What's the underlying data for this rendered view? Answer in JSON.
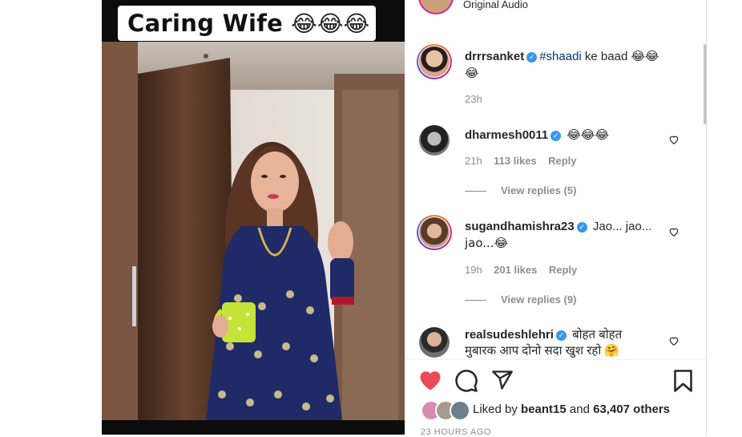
{
  "video": {
    "caption_title": "Caring Wife",
    "caption_emojis": "😂😂😂"
  },
  "audio": {
    "label": "Original Audio"
  },
  "post": {
    "username": "drrrsanket",
    "hashtag": "#shaadi",
    "text": " ke baad ",
    "emojis": "😂😂",
    "emojis_line2": "😂",
    "age": "23h"
  },
  "comments": [
    {
      "username": "dharmesh0011",
      "text": "😂😂😂",
      "age": "21h",
      "likes": "113 likes",
      "reply_label": "Reply",
      "view_replies": "View replies (5)"
    },
    {
      "username": "sugandhamishra23",
      "text": "Jao... jao...",
      "text_line2": "jao...😂",
      "age": "19h",
      "likes": "201 likes",
      "reply_label": "Reply",
      "view_replies": "View replies (9)"
    },
    {
      "username": "realsudeshlehri",
      "text": "बोहत बोहत",
      "text_line2": "मुबारक आप दोनो सदा खुश रहो 🤗"
    }
  ],
  "likes": {
    "prefix": "Liked by ",
    "user": "beant15",
    "middle": " and ",
    "others": "63,407 others"
  },
  "timestamp": "23 HOURS AGO",
  "icons": [
    "heart-icon",
    "comment-icon",
    "share-icon",
    "bookmark-icon",
    "verified-icon"
  ],
  "colors": {
    "liked_red": "#ed4956",
    "verified_blue": "#3897f0",
    "hashtag": "#00376b",
    "muted": "#8e8e8e"
  }
}
